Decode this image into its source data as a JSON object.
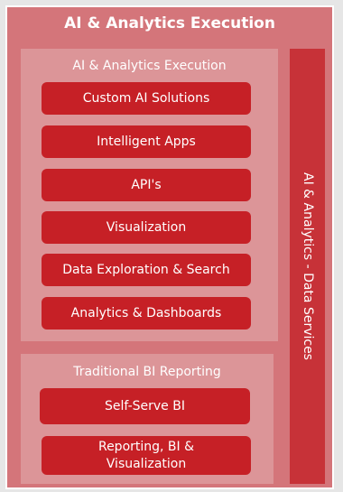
{
  "title": "AI & Analytics Execution",
  "execution_panel": {
    "title": "AI & Analytics Execution",
    "items": [
      "Custom AI Solutions",
      "Intelligent Apps",
      "API's",
      "Visualization",
      "Data Exploration & Search",
      "Analytics & Dashboards"
    ]
  },
  "bi_panel": {
    "title": "Traditional BI Reporting",
    "items": [
      "Self-Serve BI",
      "Reporting, BI & Visualization"
    ]
  },
  "side_bar": {
    "label": "AI & Analytics - Data Services"
  },
  "colors": {
    "background": "#e6e6e6",
    "outer": "#d4757a",
    "panel": "#dc9598",
    "box": "#c62026",
    "side_bar": "#c73238",
    "text": "#ffffff"
  }
}
